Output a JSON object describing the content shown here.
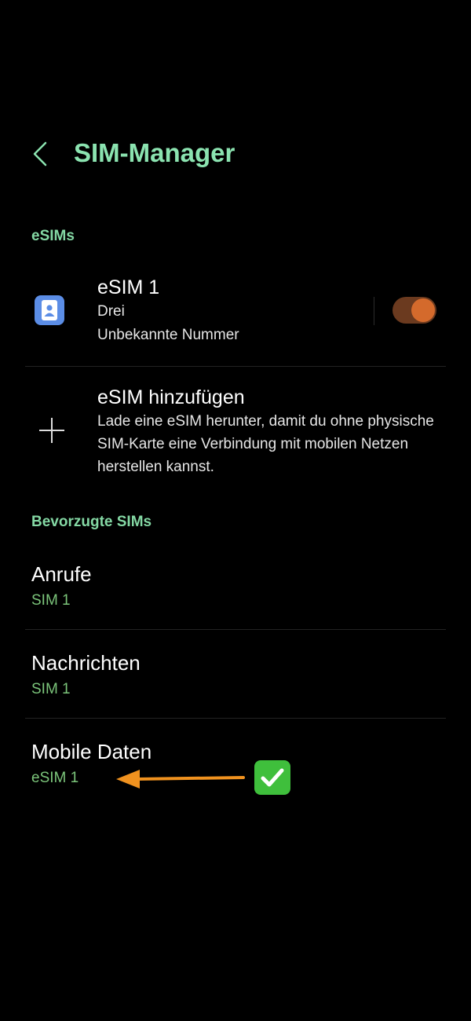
{
  "header": {
    "title": "SIM-Manager"
  },
  "sections": {
    "esims": "eSIMs",
    "preferred": "Bevorzugte SIMs"
  },
  "esim1": {
    "title": "eSIM 1",
    "carrier": "Drei",
    "number": "Unbekannte Nummer",
    "enabled": true
  },
  "add_esim": {
    "title": "eSIM hinzufügen",
    "description": "Lade eine eSIM herunter, damit du ohne physische SIM-Karte eine Verbindung mit mobilen Netzen herstellen kannst."
  },
  "preferred": [
    {
      "title": "Anrufe",
      "value": "SIM 1"
    },
    {
      "title": "Nachrichten",
      "value": "SIM 1"
    },
    {
      "title": "Mobile Daten",
      "value": "eSIM 1"
    }
  ],
  "colors": {
    "title": "#8be3b0",
    "section": "#84d8a4",
    "value": "#7bc47a",
    "toggle_track": "#6b3a1f",
    "toggle_knob": "#d46a2c",
    "annotation_arrow": "#f0921f",
    "checkmark_bg": "#3fbf3c"
  },
  "icons": {
    "back": "chevron-left-icon",
    "sim": "sim-card-icon",
    "add": "plus-icon",
    "annotation": "arrow-left-icon",
    "check": "checkmark-emoji-icon"
  }
}
